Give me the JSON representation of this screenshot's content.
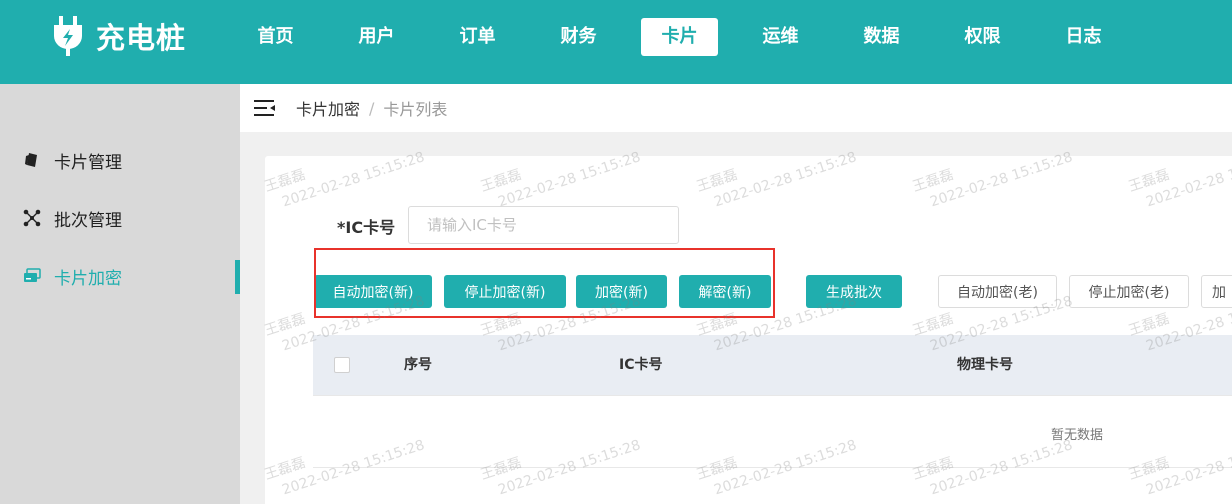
{
  "header": {
    "app_name": "充电桩",
    "logo_icon": "plug-icon",
    "nav": [
      "首页",
      "用户",
      "订单",
      "财务",
      "卡片",
      "运维",
      "数据",
      "权限",
      "日志"
    ],
    "active_nav": "卡片"
  },
  "sidebar": {
    "items": [
      {
        "label": "卡片管理",
        "icon": "card-icon"
      },
      {
        "label": "批次管理",
        "icon": "network-icon"
      },
      {
        "label": "卡片加密",
        "icon": "cards-stack-icon"
      }
    ],
    "active_item": "卡片加密"
  },
  "breadcrumb": {
    "items": [
      "卡片加密",
      "卡片列表"
    ],
    "separator": "/"
  },
  "form": {
    "ic_label": "*IC卡号",
    "ic_placeholder": "请输入IC卡号",
    "ic_value": ""
  },
  "buttons": {
    "auto_encrypt_new": "自动加密(新)",
    "stop_encrypt_new": "停止加密(新)",
    "encrypt_new": "加密(新)",
    "decrypt_new": "解密(新)",
    "generate_batch": "生成批次",
    "auto_encrypt_old": "自动加密(老)",
    "stop_encrypt_old": "停止加密(老)",
    "encrypt_old_partial": "加"
  },
  "table": {
    "columns": [
      "序号",
      "IC卡号",
      "物理卡号"
    ],
    "rows": [],
    "empty_text": "暂无数据"
  },
  "watermark": {
    "name": "王磊磊",
    "datetime": "2022-02-28 15:15:28"
  },
  "colors": {
    "primary": "#20aeae",
    "highlight_frame": "#e8322b",
    "sidebar_bg": "#d9d9d9",
    "table_header_bg": "#e9edf3"
  }
}
